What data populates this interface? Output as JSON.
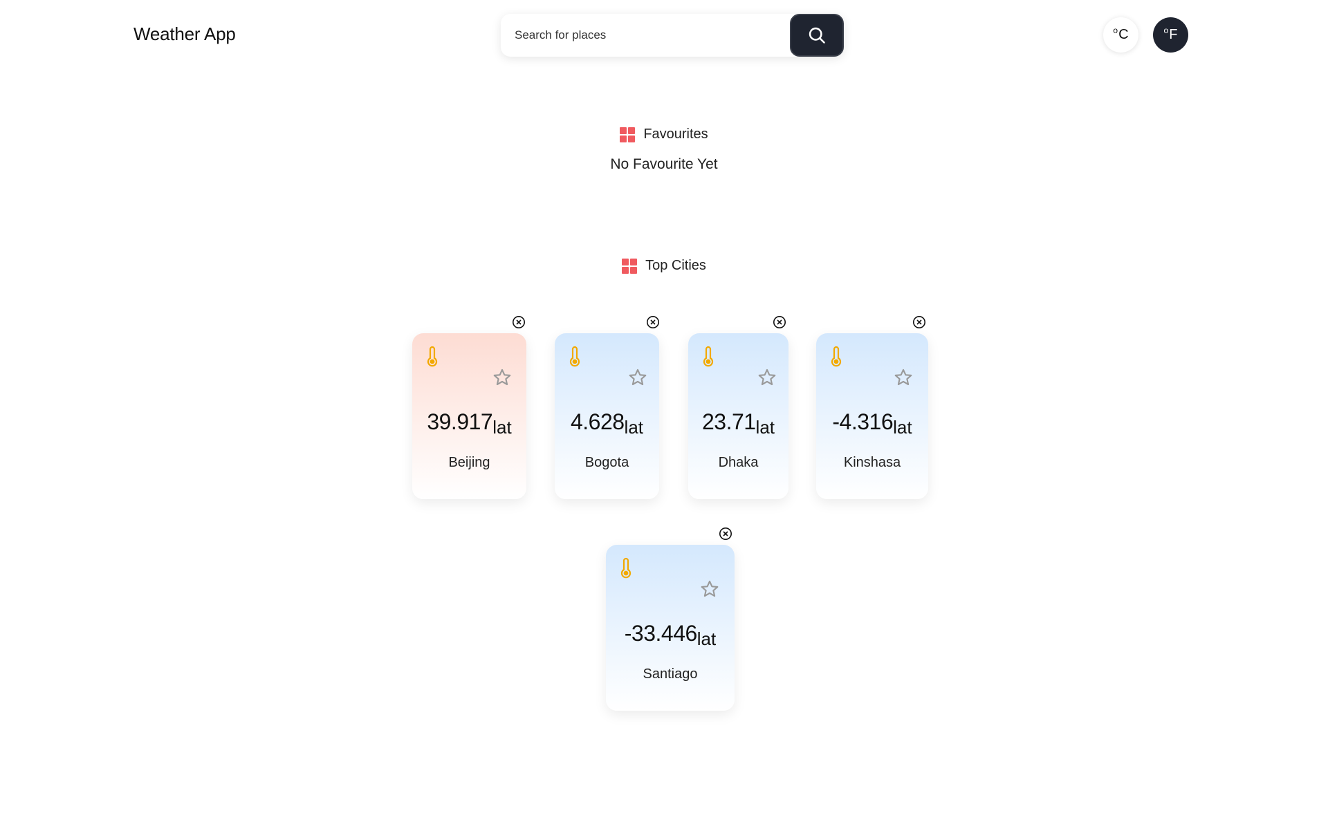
{
  "header": {
    "app_title": "Weather App",
    "search_placeholder": "Search for places",
    "unit_c": "C",
    "unit_f": "F",
    "degree_symbol": "o"
  },
  "favourites": {
    "heading": "Favourites",
    "empty_text": "No Favourite Yet"
  },
  "top_cities": {
    "heading": "Top Cities",
    "lat_unit": "lat",
    "cities": [
      {
        "name": "Beijing",
        "lat": "39.917",
        "theme": "warm"
      },
      {
        "name": "Bogota",
        "lat": "4.628",
        "theme": "cool"
      },
      {
        "name": "Dhaka",
        "lat": "23.71",
        "theme": "cool"
      },
      {
        "name": "Kinshasa",
        "lat": "-4.316",
        "theme": "cool"
      },
      {
        "name": "Santiago",
        "lat": "-33.446",
        "theme": "cool"
      }
    ]
  },
  "colors": {
    "accent_red": "#f05a5f",
    "dark_button": "#1f2430",
    "thermometer": "#f2a900",
    "star_outline": "#999999"
  }
}
